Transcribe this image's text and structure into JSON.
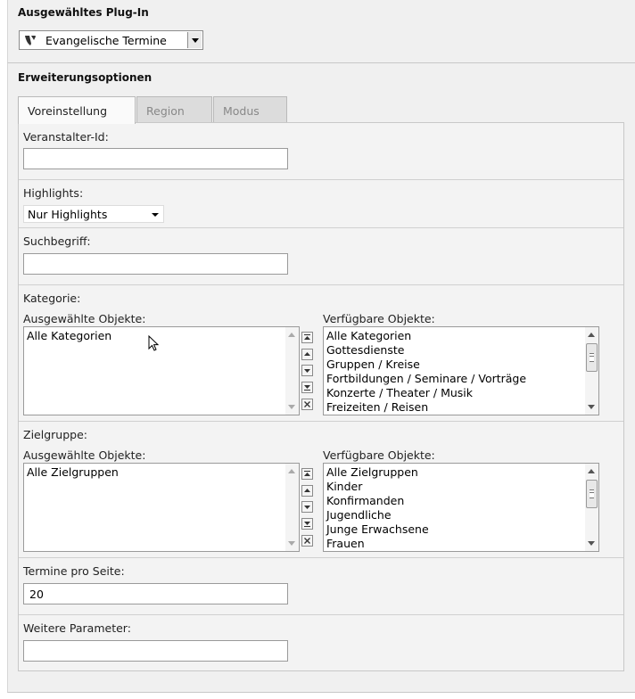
{
  "plugin": {
    "section_title": "Ausgewähltes Plug-In",
    "selected": "Evangelische Termine",
    "logo_icon": "typo3-logo-icon"
  },
  "options": {
    "section_title": "Erweiterungsoptionen",
    "tabs": [
      {
        "label": "Voreinstellung",
        "active": true
      },
      {
        "label": "Region",
        "active": false
      },
      {
        "label": "Modus",
        "active": false
      }
    ]
  },
  "form": {
    "veranstalter": {
      "label": "Veranstalter-Id:",
      "value": ""
    },
    "highlights": {
      "label": "Highlights:",
      "selected": "Nur Highlights"
    },
    "suchbegriff": {
      "label": "Suchbegriff:",
      "value": ""
    },
    "kategorie": {
      "label": "Kategorie:",
      "selected_label": "Ausgewählte Objekte:",
      "available_label": "Verfügbare Objekte:",
      "selected_items": [
        "Alle Kategorien"
      ],
      "available_items": [
        "Alle Kategorien",
        "Gottesdienste",
        "Gruppen / Kreise",
        "Fortbildungen / Seminare / Vorträge",
        "Konzerte / Theater / Musik",
        "Freizeiten / Reisen"
      ]
    },
    "zielgruppe": {
      "label": "Zielgruppe:",
      "selected_label": "Ausgewählte Objekte:",
      "available_label": "Verfügbare Objekte:",
      "selected_items": [
        "Alle Zielgruppen"
      ],
      "available_items": [
        "Alle Zielgruppen",
        "Kinder",
        "Konfirmanden",
        "Jugendliche",
        "Junge Erwachsene",
        "Frauen"
      ]
    },
    "termine": {
      "label": "Termine pro Seite:",
      "value": "20"
    },
    "weitere": {
      "label": "Weitere Parameter:",
      "value": ""
    }
  },
  "move_buttons": [
    "move-top-icon",
    "move-up-icon",
    "move-down-icon",
    "move-bottom-icon",
    "remove-icon"
  ]
}
